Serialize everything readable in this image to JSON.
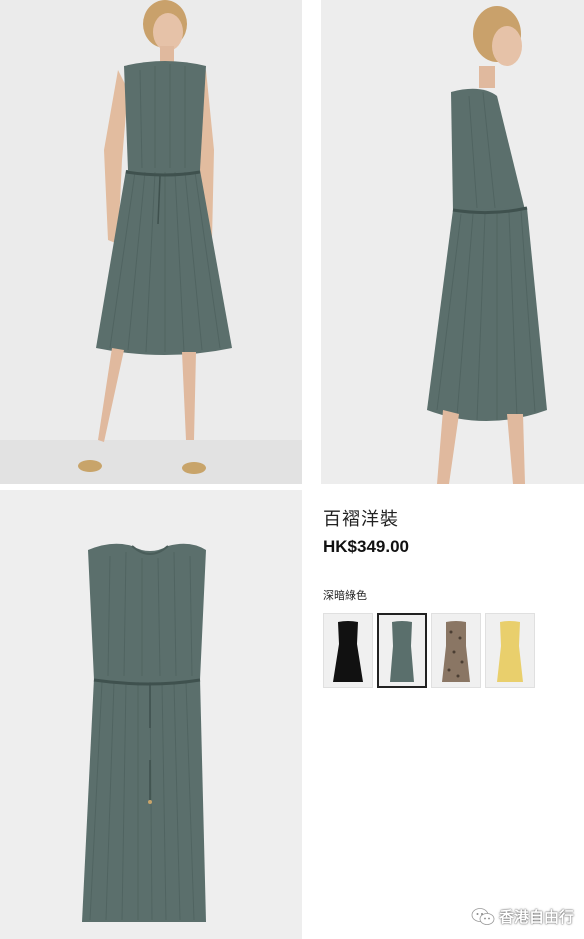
{
  "product": {
    "name": "百褶洋裝",
    "price": "HK$349.00"
  },
  "color_selector": {
    "label": "深暗綠色",
    "swatches": [
      {
        "name": "black",
        "color": "#111111",
        "selected": false
      },
      {
        "name": "dark-green",
        "color": "#5a6f6c",
        "selected": true
      },
      {
        "name": "leopard",
        "color": "#8a7664",
        "selected": false
      },
      {
        "name": "yellow",
        "color": "#e9cf6c",
        "selected": false
      }
    ]
  },
  "colors": {
    "dress": "#5b6f6c",
    "dress_shadow": "#4a5d5a",
    "skin": "#e6c2a8",
    "hair": "#c9a16b"
  },
  "watermark": {
    "text": "香港自由行",
    "icon": "wechat-icon"
  }
}
